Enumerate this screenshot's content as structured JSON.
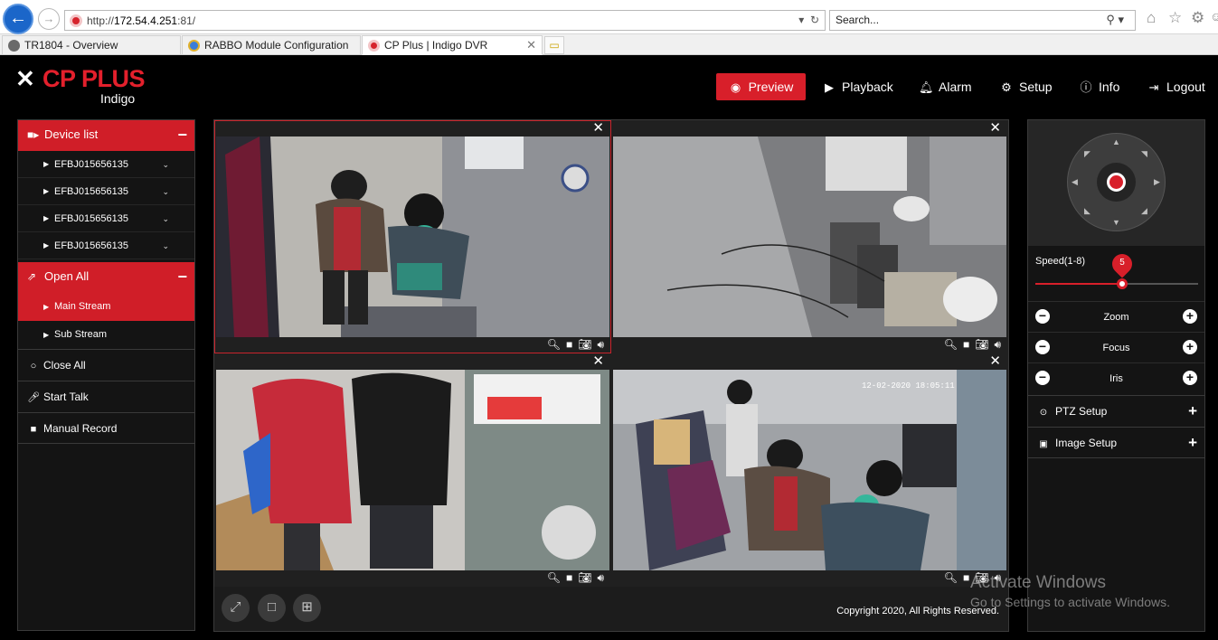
{
  "browser": {
    "back_glyph": "←",
    "forward_glyph": "→",
    "url_prefix": "http://",
    "url_host": "172.54.4.251",
    "url_port": ":81/",
    "search_placeholder": "Search...",
    "tabs": [
      {
        "title": "TR1804 - Overview"
      },
      {
        "title": "RABBO Module Configuration"
      },
      {
        "title": "CP Plus | Indigo DVR"
      }
    ]
  },
  "header": {
    "logo_mark": "✕",
    "brand": "CP PLUS",
    "product": "Indigo",
    "nav": [
      {
        "label": "Preview"
      },
      {
        "label": "Playback"
      },
      {
        "label": "Alarm"
      },
      {
        "label": "Setup"
      },
      {
        "label": "Info"
      },
      {
        "label": "Logout"
      }
    ]
  },
  "left_panel": {
    "device_list_label": "Device list",
    "devices": [
      {
        "label": "EFBJ015656135"
      },
      {
        "label": "EFBJ015656135"
      },
      {
        "label": "EFBJ015656135"
      },
      {
        "label": "EFBJ015656135"
      }
    ],
    "open_all_label": "Open All",
    "streams": [
      {
        "label": "Main Stream"
      },
      {
        "label": "Sub Stream"
      }
    ],
    "close_all_label": "Close All",
    "start_talk_label": "Start Talk",
    "manual_record_label": "Manual Record"
  },
  "video": {
    "cameras": [
      {
        "timestamp": "",
        "footer": ""
      },
      {
        "timestamp": "",
        "footer": ""
      },
      {
        "timestamp": "",
        "footer": ""
      },
      {
        "timestamp": "12-02-2020 18:05:11",
        "footer": ""
      }
    ],
    "copyright": "Copyright 2020, All Rights Reserved."
  },
  "ptz": {
    "speed_label": "Speed(1-8)",
    "speed_value": 5,
    "speed_max": 8,
    "zoom_label": "Zoom",
    "focus_label": "Focus",
    "iris_label": "Iris",
    "ptz_setup_label": "PTZ Setup",
    "image_setup_label": "Image Setup"
  },
  "watermark": {
    "title": "Activate Windows",
    "subtitle": "Go to Settings to activate Windows."
  },
  "colors": {
    "accent_red": "#d81f2a",
    "panel_bg": "#141414",
    "browser_blue": "#1b66c9"
  }
}
